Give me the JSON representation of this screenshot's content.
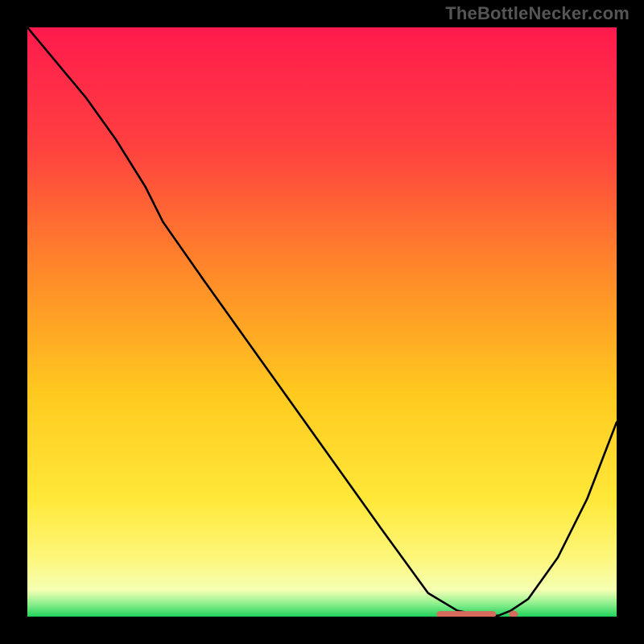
{
  "watermark": "TheBottleNecker.com",
  "chart_data": {
    "type": "line",
    "title": "",
    "xlabel": "",
    "ylabel": "",
    "xlim": [
      0,
      100
    ],
    "ylim": [
      0,
      100
    ],
    "series": [
      {
        "name": "curve",
        "x": [
          0,
          5,
          10,
          15,
          20,
          23,
          30,
          40,
          50,
          60,
          68,
          73,
          78,
          80,
          82,
          85,
          90,
          95,
          100
        ],
        "y": [
          100,
          94,
          88,
          81,
          73,
          67,
          57,
          43,
          29,
          15,
          4,
          1,
          0,
          0.2,
          1,
          3,
          10,
          20,
          33
        ]
      }
    ],
    "markers": {
      "name": "bottom-cluster",
      "color": "#d66a5d",
      "x": [
        70,
        71.5,
        73,
        74.5,
        76,
        77.5,
        79,
        82.5
      ],
      "y": [
        0.4,
        0.4,
        0.4,
        0.4,
        0.4,
        0.4,
        0.4,
        0.4
      ]
    },
    "gradient_stops": [
      {
        "offset": 0.0,
        "color": "#ff1a4d"
      },
      {
        "offset": 0.2,
        "color": "#ff4040"
      },
      {
        "offset": 0.42,
        "color": "#ff8a28"
      },
      {
        "offset": 0.62,
        "color": "#ffc91f"
      },
      {
        "offset": 0.8,
        "color": "#ffe838"
      },
      {
        "offset": 0.9,
        "color": "#fdf77a"
      },
      {
        "offset": 0.955,
        "color": "#f5ffb3"
      },
      {
        "offset": 0.978,
        "color": "#8ef08e"
      },
      {
        "offset": 1.0,
        "color": "#1fd15c"
      }
    ]
  }
}
